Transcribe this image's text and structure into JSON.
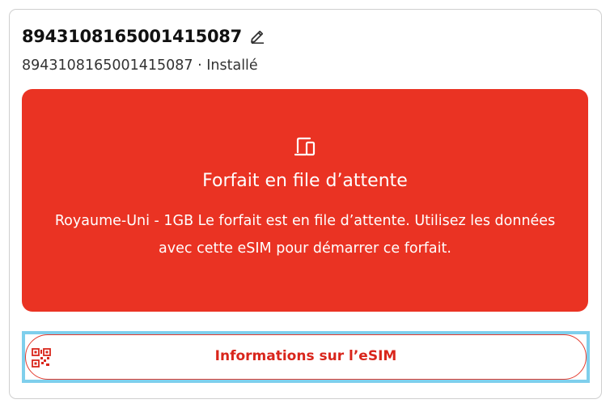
{
  "sim": {
    "title": "8943108165001415087",
    "subtitle": "8943108165001415087 · Installé",
    "edit_icon": "pencil-icon"
  },
  "banner": {
    "background": "#ea3323",
    "icon": "devices-icon",
    "heading": "Forfait en file d’attente",
    "body": "Royaume-Uni - 1GB Le forfait est en file d’attente. Utilisez les données avec cette eSIM pour démarrer ce forfait."
  },
  "esim_button": {
    "icon": "qr-code-icon",
    "label": "Informations sur l’eSIM",
    "accent": "#d9261c",
    "focus_ring": "#7fcfec"
  }
}
